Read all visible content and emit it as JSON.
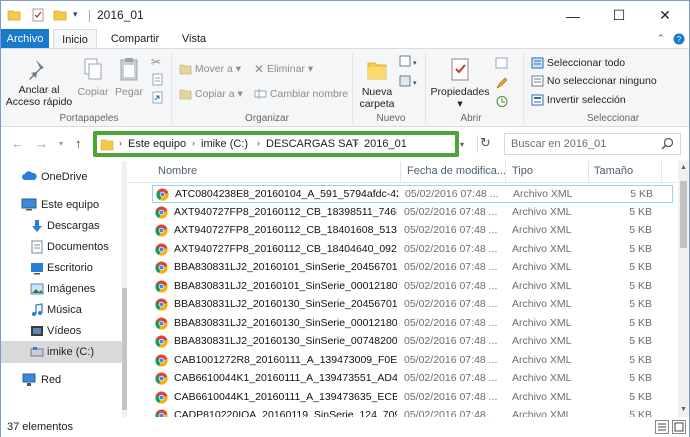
{
  "window": {
    "title": "2016_01",
    "controls": {
      "minimize": "—",
      "maximize": "☐",
      "close": "✕"
    }
  },
  "ribbon_tabs": {
    "archivo": "Archivo",
    "inicio": "Inicio",
    "compartir": "Compartir",
    "vista": "Vista"
  },
  "ribbon": {
    "portapapeles": {
      "anclar": "Anclar al",
      "anclar2": "Acceso rápido",
      "copiar": "Copiar",
      "pegar": "Pegar",
      "label": "Portapapeles"
    },
    "organizar": {
      "mover": "Mover a",
      "copiar_a": "Copiar a",
      "eliminar": "Eliminar",
      "cambiar_nombre": "Cambiar nombre",
      "label": "Organizar"
    },
    "nuevo": {
      "nueva": "Nueva",
      "carpeta": "carpeta",
      "label": "Nuevo"
    },
    "abrir": {
      "propiedades": "Propiedades",
      "label": "Abrir"
    },
    "seleccionar": {
      "todo": "Seleccionar todo",
      "ninguno": "No seleccionar ninguno",
      "invertir": "Invertir selección",
      "label": "Seleccionar"
    }
  },
  "address": {
    "crumbs": [
      "Este equipo",
      "imike (C:)",
      "DESCARGAS SAT",
      "2016_01"
    ]
  },
  "search": {
    "placeholder": "Buscar en 2016_01"
  },
  "nav_pane": {
    "items": [
      {
        "label": "OneDrive",
        "icon": "cloud-icon"
      },
      {
        "label": "Este equipo",
        "icon": "computer-icon"
      },
      {
        "label": "Descargas",
        "icon": "download-icon"
      },
      {
        "label": "Documentos",
        "icon": "documents-icon"
      },
      {
        "label": "Escritorio",
        "icon": "desktop-icon"
      },
      {
        "label": "Imágenes",
        "icon": "pictures-icon"
      },
      {
        "label": "Música",
        "icon": "music-icon"
      },
      {
        "label": "Vídeos",
        "icon": "videos-icon"
      },
      {
        "label": "imike (C:)",
        "icon": "drive-icon"
      },
      {
        "label": "Red",
        "icon": "network-icon"
      }
    ]
  },
  "columns": {
    "nombre": "Nombre",
    "fecha": "Fecha de modifica...",
    "tipo": "Tipo",
    "tamano": "Tamaño"
  },
  "files": [
    {
      "name": "ATC0804238E8_20160104_A_591_5794afdc-426...",
      "date": "05/02/2016 07:48 ...",
      "type": "Archivo XML",
      "size": "5 KB"
    },
    {
      "name": "AXT940727FP8_20160112_CB_18398511_746E5...",
      "date": "05/02/2016 07:48 ...",
      "type": "Archivo XML",
      "size": "5 KB"
    },
    {
      "name": "AXT940727FP8_20160112_CB_18401608_5139D...",
      "date": "05/02/2016 07:48 ...",
      "type": "Archivo XML",
      "size": "5 KB"
    },
    {
      "name": "AXT940727FP8_20160112_CB_18404640_0928C...",
      "date": "05/02/2016 07:48 ...",
      "type": "Archivo XML",
      "size": "5 KB"
    },
    {
      "name": "BBA830831LJ2_20160101_SinSerie_2045670128...",
      "date": "05/02/2016 07:48 ...",
      "type": "Archivo XML",
      "size": "5 KB"
    },
    {
      "name": "BBA830831LJ2_20160101_SinSerie_0001218000...",
      "date": "05/02/2016 07:48 ...",
      "type": "Archivo XML",
      "size": "5 KB"
    },
    {
      "name": "BBA830831LJ2_20160130_SinSerie_2045670128...",
      "date": "05/02/2016 07:48 ...",
      "type": "Archivo XML",
      "size": "5 KB"
    },
    {
      "name": "BBA830831LJ2_20160130_SinSerie_0001218000...",
      "date": "05/02/2016 07:48 ...",
      "type": "Archivo XML",
      "size": "5 KB"
    },
    {
      "name": "BBA830831LJ2_20160130_SinSerie_0074820001...",
      "date": "05/02/2016 07:48 ...",
      "type": "Archivo XML",
      "size": "5 KB"
    },
    {
      "name": "CAB1001272R8_20160111_A_139473009_F0E7B...",
      "date": "05/02/2016 07:48 ...",
      "type": "Archivo XML",
      "size": "5 KB"
    },
    {
      "name": "CAB6610044K1_20160111_A_139473551_AD46...",
      "date": "05/02/2016 07:48 ...",
      "type": "Archivo XML",
      "size": "5 KB"
    },
    {
      "name": "CAB6610044K1_20160111_A_139473635_ECB7F...",
      "date": "05/02/2016 07:48 ...",
      "type": "Archivo XML",
      "size": "5 KB"
    },
    {
      "name": "CADP810220IQA_20160119_SinSerie_124_709E...",
      "date": "05/02/2016 07:48 ...",
      "type": "Archivo XML",
      "size": "5 KB"
    }
  ],
  "status": {
    "count": "37 elementos"
  },
  "colors": {
    "accent": "#1979ca",
    "highlight": "#4ea535",
    "selection": "#99d1ff"
  }
}
